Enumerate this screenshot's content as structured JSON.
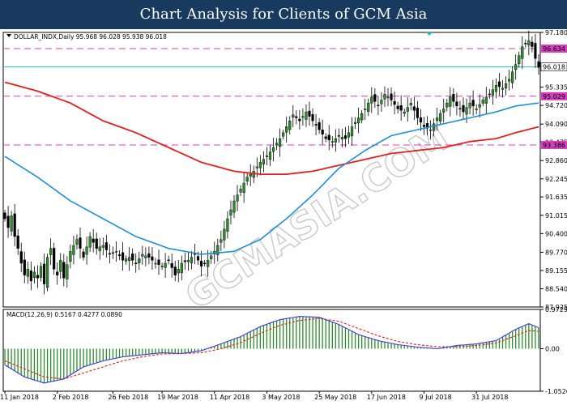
{
  "header": {
    "title": "Chart Analysis for Clients of GCM Asia"
  },
  "watermark": "GCMASIA.COM",
  "colors": {
    "header_bg": "#173a5e",
    "bull": "#2d8a2d",
    "bear": "#000000",
    "sma_fast": "#1e8fd6",
    "sma_slow": "#e02020",
    "levels": "#d63fbd",
    "current": "#20c0c0",
    "macd_line": "#3a3ad8",
    "signal_line": "#e02020",
    "hist": "#2d8a2d"
  },
  "chart_data": [
    {
      "type": "candlestick",
      "symbol_label": "DOLLAR_INDX,Daily",
      "ohlc_label": "95.968 96.028 95.938 96.018",
      "current_price": 96.018,
      "current_price_label": "96.018",
      "levels": [
        96.634,
        95.029,
        93.386
      ],
      "level_labels": [
        "96.634",
        "95.029",
        "93.386"
      ],
      "ylim": [
        87.925,
        97.18
      ],
      "y_ticks": [
        97.18,
        96.018,
        95.335,
        94.72,
        94.09,
        93.475,
        92.86,
        92.245,
        91.635,
        91.015,
        90.4,
        89.77,
        89.155,
        88.54,
        87.925
      ],
      "y_tick_labels": [
        "97.180",
        "96.018",
        "95.335",
        "94.720",
        "94.090",
        "93.475",
        "92.860",
        "92.245",
        "91.635",
        "91.015",
        "90.400",
        "89.770",
        "89.155",
        "88.540",
        "87.925"
      ],
      "x_tick_labels": [
        "11 Jan 2018",
        "2 Feb 2018",
        "26 Feb 2018",
        "19 Mar 2018",
        "11 Apr 2018",
        "3 May 2018",
        "25 May 2018",
        "17 Jun 2018",
        "9 Jul 2018",
        "31 Jul 2018"
      ],
      "x_tick_index": [
        0,
        16,
        33,
        48,
        64,
        80,
        96,
        112,
        128,
        144
      ],
      "close_anchors": [
        [
          0,
          90.9
        ],
        [
          1,
          90.6
        ],
        [
          2,
          91.0
        ],
        [
          3,
          90.3
        ],
        [
          4,
          89.9
        ],
        [
          5,
          89.4
        ],
        [
          6,
          89.0
        ],
        [
          7,
          89.2
        ],
        [
          8,
          88.8
        ],
        [
          9,
          89.1
        ],
        [
          10,
          88.9
        ],
        [
          11,
          89.3
        ],
        [
          12,
          88.7
        ],
        [
          13,
          89.6
        ],
        [
          14,
          89.9
        ],
        [
          15,
          89.2
        ],
        [
          16,
          89.0
        ],
        [
          17,
          89.5
        ],
        [
          18,
          88.9
        ],
        [
          20,
          89.8
        ],
        [
          22,
          90.2
        ],
        [
          24,
          89.6
        ],
        [
          26,
          90.3
        ],
        [
          28,
          89.9
        ],
        [
          30,
          90.0
        ],
        [
          32,
          89.7
        ],
        [
          34,
          89.8
        ],
        [
          36,
          89.5
        ],
        [
          38,
          89.6
        ],
        [
          40,
          89.4
        ],
        [
          42,
          89.7
        ],
        [
          44,
          89.6
        ],
        [
          46,
          89.4
        ],
        [
          48,
          89.3
        ],
        [
          50,
          89.5
        ],
        [
          52,
          89.0
        ],
        [
          54,
          89.4
        ],
        [
          56,
          89.5
        ],
        [
          58,
          89.7
        ],
        [
          60,
          89.3
        ],
        [
          62,
          89.5
        ],
        [
          64,
          89.8
        ],
        [
          66,
          90.2
        ],
        [
          68,
          90.9
        ],
        [
          70,
          91.5
        ],
        [
          72,
          91.9
        ],
        [
          74,
          92.3
        ],
        [
          76,
          92.5
        ],
        [
          78,
          92.8
        ],
        [
          80,
          93.0
        ],
        [
          82,
          93.3
        ],
        [
          84,
          93.6
        ],
        [
          86,
          94.0
        ],
        [
          88,
          94.4
        ],
        [
          90,
          94.2
        ],
        [
          92,
          94.5
        ],
        [
          94,
          94.2
        ],
        [
          96,
          93.9
        ],
        [
          98,
          93.6
        ],
        [
          100,
          93.5
        ],
        [
          102,
          93.7
        ],
        [
          104,
          93.6
        ],
        [
          106,
          94.0
        ],
        [
          108,
          94.3
        ],
        [
          110,
          94.6
        ],
        [
          112,
          95.0
        ],
        [
          114,
          94.7
        ],
        [
          116,
          95.1
        ],
        [
          118,
          94.9
        ],
        [
          120,
          94.6
        ],
        [
          122,
          94.5
        ],
        [
          124,
          94.8
        ],
        [
          126,
          94.3
        ],
        [
          128,
          94.0
        ],
        [
          130,
          93.9
        ],
        [
          132,
          94.3
        ],
        [
          134,
          94.6
        ],
        [
          136,
          95.0
        ],
        [
          138,
          94.7
        ],
        [
          140,
          94.5
        ],
        [
          142,
          94.8
        ],
        [
          144,
          94.6
        ],
        [
          146,
          94.9
        ],
        [
          148,
          95.1
        ],
        [
          150,
          95.4
        ],
        [
          152,
          95.3
        ],
        [
          154,
          95.6
        ],
        [
          156,
          96.1
        ],
        [
          158,
          96.7
        ],
        [
          160,
          96.9
        ],
        [
          161,
          96.7
        ],
        [
          162,
          96.3
        ],
        [
          163,
          96.0
        ]
      ],
      "sma_fast_anchors": [
        [
          0,
          93.0
        ],
        [
          10,
          92.3
        ],
        [
          20,
          91.5
        ],
        [
          30,
          90.9
        ],
        [
          40,
          90.3
        ],
        [
          50,
          89.9
        ],
        [
          60,
          89.7
        ],
        [
          70,
          89.8
        ],
        [
          78,
          90.2
        ],
        [
          86,
          90.9
        ],
        [
          94,
          91.7
        ],
        [
          102,
          92.6
        ],
        [
          110,
          93.2
        ],
        [
          118,
          93.7
        ],
        [
          126,
          93.9
        ],
        [
          134,
          94.1
        ],
        [
          142,
          94.3
        ],
        [
          150,
          94.5
        ],
        [
          156,
          94.7
        ],
        [
          163,
          94.8
        ]
      ],
      "sma_slow_anchors": [
        [
          0,
          95.5
        ],
        [
          10,
          95.2
        ],
        [
          20,
          94.8
        ],
        [
          30,
          94.2
        ],
        [
          40,
          93.8
        ],
        [
          50,
          93.3
        ],
        [
          60,
          92.8
        ],
        [
          70,
          92.5
        ],
        [
          78,
          92.4
        ],
        [
          86,
          92.4
        ],
        [
          94,
          92.5
        ],
        [
          102,
          92.7
        ],
        [
          110,
          92.9
        ],
        [
          118,
          93.1
        ],
        [
          126,
          93.2
        ],
        [
          134,
          93.3
        ],
        [
          142,
          93.5
        ],
        [
          150,
          93.6
        ],
        [
          156,
          93.8
        ],
        [
          163,
          94.0
        ]
      ]
    },
    {
      "type": "line",
      "title": "MACD(12,26,9) 0.5167 0.4277 0.0890",
      "ylim": [
        -1.0526,
        0.9729
      ],
      "y_ticks": [
        0.9729,
        0.0,
        -1.0526
      ],
      "y_tick_labels": [
        "0.9729",
        "0.00",
        "-1.0526"
      ],
      "macd_anchors": [
        [
          0,
          -0.4
        ],
        [
          6,
          -0.7
        ],
        [
          12,
          -0.85
        ],
        [
          18,
          -0.75
        ],
        [
          24,
          -0.45
        ],
        [
          30,
          -0.3
        ],
        [
          36,
          -0.2
        ],
        [
          42,
          -0.15
        ],
        [
          48,
          -0.1
        ],
        [
          54,
          -0.12
        ],
        [
          60,
          -0.05
        ],
        [
          66,
          0.12
        ],
        [
          72,
          0.3
        ],
        [
          78,
          0.55
        ],
        [
          84,
          0.72
        ],
        [
          90,
          0.8
        ],
        [
          96,
          0.78
        ],
        [
          102,
          0.6
        ],
        [
          108,
          0.35
        ],
        [
          114,
          0.2
        ],
        [
          120,
          0.1
        ],
        [
          126,
          0.04
        ],
        [
          132,
          0.0
        ],
        [
          138,
          0.08
        ],
        [
          144,
          0.12
        ],
        [
          150,
          0.2
        ],
        [
          156,
          0.48
        ],
        [
          160,
          0.62
        ],
        [
          163,
          0.52
        ]
      ],
      "signal_anchors": [
        [
          0,
          -0.3
        ],
        [
          6,
          -0.5
        ],
        [
          12,
          -0.7
        ],
        [
          18,
          -0.75
        ],
        [
          24,
          -0.6
        ],
        [
          30,
          -0.45
        ],
        [
          36,
          -0.3
        ],
        [
          42,
          -0.2
        ],
        [
          48,
          -0.13
        ],
        [
          54,
          -0.12
        ],
        [
          60,
          -0.1
        ],
        [
          66,
          0.0
        ],
        [
          72,
          0.15
        ],
        [
          78,
          0.38
        ],
        [
          84,
          0.58
        ],
        [
          90,
          0.7
        ],
        [
          96,
          0.75
        ],
        [
          102,
          0.68
        ],
        [
          108,
          0.5
        ],
        [
          114,
          0.32
        ],
        [
          120,
          0.18
        ],
        [
          126,
          0.1
        ],
        [
          132,
          0.05
        ],
        [
          138,
          0.05
        ],
        [
          144,
          0.08
        ],
        [
          150,
          0.14
        ],
        [
          156,
          0.32
        ],
        [
          160,
          0.45
        ],
        [
          163,
          0.43
        ]
      ]
    }
  ]
}
